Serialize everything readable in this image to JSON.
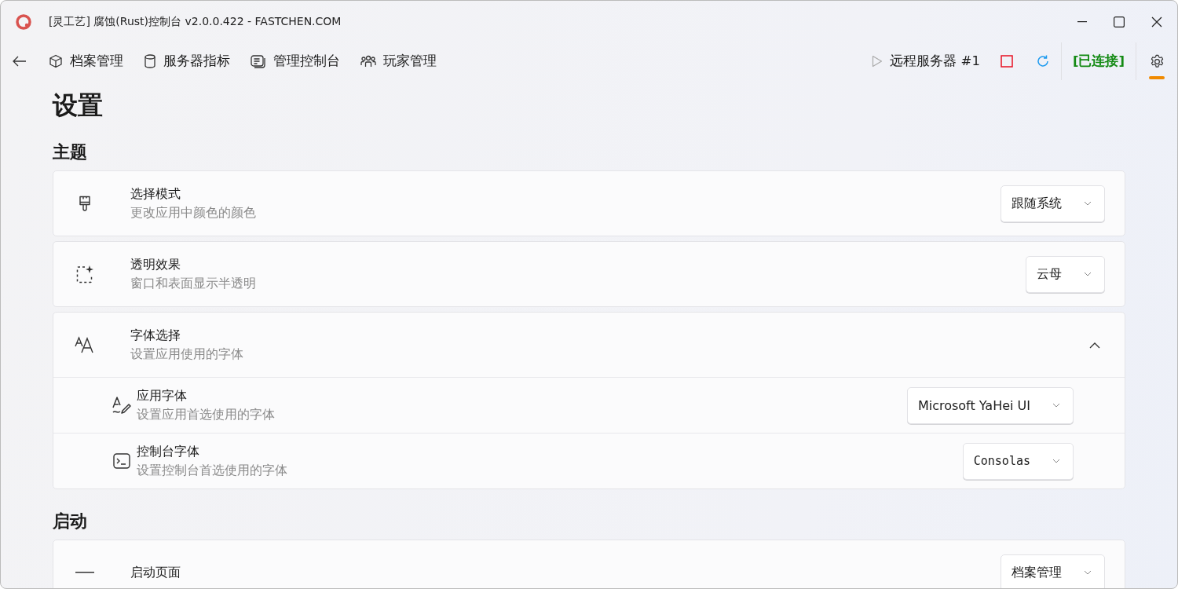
{
  "window": {
    "title": "[灵工艺] 腐蚀(Rust)控制台 v2.0.0.422 - FASTCHEN.COM"
  },
  "nav": {
    "items": [
      {
        "label": "档案管理",
        "selected": false
      },
      {
        "label": "服务器指标",
        "selected": false
      },
      {
        "label": "管理控制台",
        "selected": false
      },
      {
        "label": "玩家管理",
        "selected": false
      }
    ],
    "server": {
      "label": "远程服务器 #1",
      "status": "[已连接]"
    },
    "settings_selected": true
  },
  "page": {
    "title": "设置"
  },
  "sections": [
    {
      "title": "主题",
      "cards": [
        {
          "kind": "dropdown",
          "title": "选择模式",
          "description": "更改应用中颜色的颜色",
          "value": "跟随系统"
        },
        {
          "kind": "dropdown",
          "title": "透明效果",
          "description": "窗口和表面显示半透明",
          "value": "云母"
        },
        {
          "kind": "expander",
          "title": "字体选择",
          "description": "设置应用使用的字体",
          "expanded": true,
          "children": [
            {
              "title": "应用字体",
              "description": "设置应用首选使用的字体",
              "value": "Microsoft YaHei UI"
            },
            {
              "title": "控制台字体",
              "description": "设置控制台首选使用的字体",
              "value": "Consolas"
            }
          ]
        }
      ]
    },
    {
      "title": "启动",
      "cards": [
        {
          "kind": "dropdown",
          "title": "启动页面",
          "value": "档案管理"
        }
      ]
    }
  ]
}
